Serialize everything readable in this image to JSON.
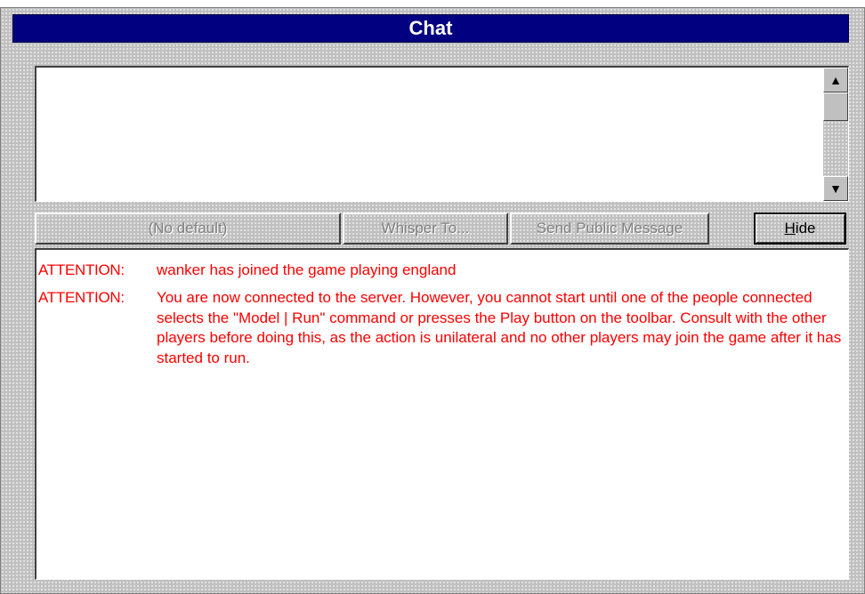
{
  "window": {
    "title": "Chat"
  },
  "buttons": {
    "default_label": "(No default)",
    "whisper_label": "Whisper To...",
    "public_label": "Send Public Message",
    "hide_label_first": "H",
    "hide_label_rest": "ide"
  },
  "scrollbar": {
    "up_icon": "arrow-up-icon",
    "down_icon": "arrow-down-icon"
  },
  "messages": [
    {
      "label": "ATTENTION:",
      "text": "wanker has joined the game playing england"
    },
    {
      "label": "ATTENTION:",
      "text": "You are now connected to the server. However, you cannot start until one of the people connected selects the \"Model | Run\" command or presses the Play button on the toolbar. Consult with the other players before doing this, as the action is unilateral and no other players may join the game after it has started to run."
    }
  ],
  "colors": {
    "titlebar": "#000080",
    "message_text": "#ff0000",
    "panel": "#c0c0c0"
  }
}
